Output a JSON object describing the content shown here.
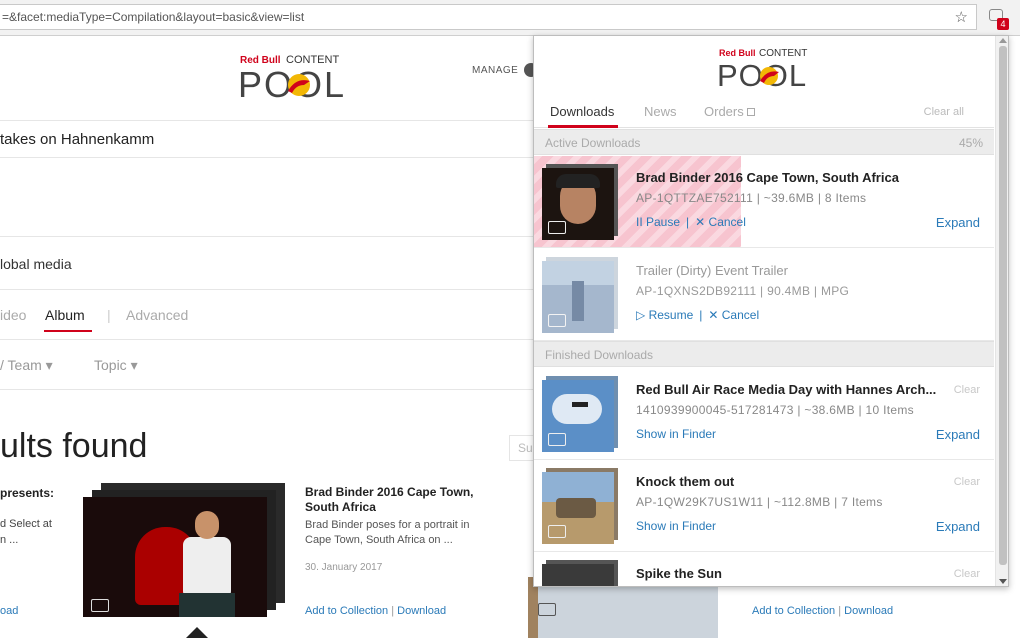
{
  "browser": {
    "url": "=&facet:mediaType=Compilation&layout=basic&view=list",
    "badge": "4"
  },
  "logo": {
    "brand": "Red Bull",
    "line1": "CONTENT",
    "line2": "POOL"
  },
  "background": {
    "manage": "MANAGE",
    "title": "takes on Hahnenkamm",
    "global_media": "lobal media",
    "tabs": {
      "video": "ideo",
      "album": "Album",
      "sep": "|",
      "advanced": "Advanced"
    },
    "filters": {
      "team": "/ Team ▾",
      "topic": "Topic ▾"
    },
    "results": "ults found",
    "search_fragment": "Su",
    "presents": "presents:",
    "presents_desc1": "d Select at",
    "presents_desc2": "n ...",
    "download_left": "oad",
    "card": {
      "title": "Brad Binder 2016 Cape Town, South Africa",
      "desc": "Brad Binder poses for a portrait in Cape Town, South Africa on ...",
      "date": "30. January 2017",
      "add": "Add to Collection",
      "sep": "|",
      "download": "Download"
    },
    "card2": {
      "add": "Add to Collection",
      "sep": "|",
      "download": "Download"
    }
  },
  "popup": {
    "tabs": {
      "downloads": "Downloads",
      "news": "News",
      "orders": "Orders"
    },
    "clear_all": "Clear all",
    "active_header": "Active Downloads",
    "active_pct": "45%",
    "finished_header": "Finished Downloads",
    "active": [
      {
        "title": "Brad Binder 2016 Cape Town, South Africa",
        "meta": "AP-1QTTZAE752111 | ~39.6MB | 8 Items",
        "action1": "II Pause",
        "sep": "|",
        "action2": "✕ Cancel",
        "progress": 0.45,
        "progress_label": "45%",
        "expand": "Expand"
      },
      {
        "title": "Trailer (Dirty) Event Trailer",
        "meta": "AP-1QXNS2DB92111 | 90.4MB | MPG",
        "action1": "▷ Resume",
        "sep": "|",
        "action2": "✕ Cancel"
      }
    ],
    "finished": [
      {
        "title": "Red Bull Air Race Media Day with Hannes Arch...",
        "meta": "1410939900045-517281473 | ~38.6MB | 10 Items",
        "action": "Show in Finder",
        "expand": "Expand",
        "clear": "Clear"
      },
      {
        "title": "Knock them out",
        "meta": "AP-1QW29K7US1W11 | ~112.8MB | 7 Items",
        "action": "Show in Finder",
        "expand": "Expand",
        "clear": "Clear"
      },
      {
        "title": "Spike the Sun",
        "clear": "Clear"
      }
    ]
  },
  "colors": {
    "accent": "#d0021b",
    "link": "#2a7ab8",
    "progress": "#f7c4cf"
  }
}
